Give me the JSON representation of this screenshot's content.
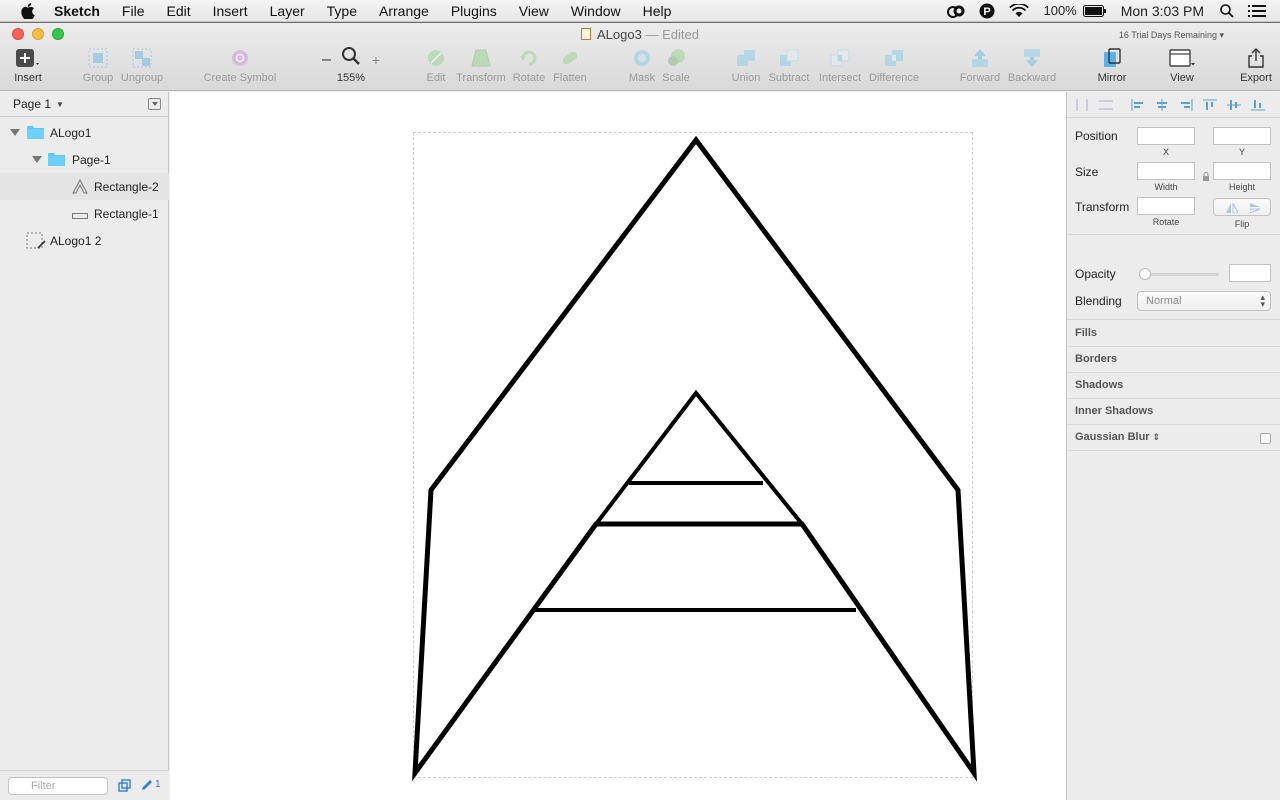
{
  "menubar": {
    "app_name": "Sketch",
    "menus": [
      "File",
      "Edit",
      "Insert",
      "Layer",
      "Type",
      "Arrange",
      "Plugins",
      "View",
      "Window",
      "Help"
    ],
    "battery": "100%",
    "clock": "Mon 3:03 PM"
  },
  "window": {
    "doc_name": "ALogo3",
    "separator": "—",
    "status": "Edited",
    "trial": "16 Trial Days Remaining"
  },
  "toolbar": {
    "insert": "Insert",
    "group": "Group",
    "ungroup": "Ungroup",
    "create_symbol": "Create Symbol",
    "zoom_minus": "–",
    "zoom_plus": "+",
    "zoom_level": "155%",
    "edit": "Edit",
    "transform": "Transform",
    "rotate": "Rotate",
    "flatten": "Flatten",
    "mask": "Mask",
    "scale": "Scale",
    "union": "Union",
    "subtract": "Subtract",
    "intersect": "Intersect",
    "difference": "Difference",
    "forward": "Forward",
    "backward": "Backward",
    "mirror": "Mirror",
    "view": "View",
    "export": "Export"
  },
  "layers": {
    "page": "Page 1",
    "items": [
      {
        "label": "ALogo1"
      },
      {
        "label": "Page-1"
      },
      {
        "label": "Rectangle-2"
      },
      {
        "label": "Rectangle-1"
      },
      {
        "label": "ALogo1 2"
      }
    ],
    "filter_placeholder": "Filter",
    "edited_count": "1"
  },
  "inspector": {
    "position": "Position",
    "x": "X",
    "y": "Y",
    "size": "Size",
    "width": "Width",
    "height": "Height",
    "transform": "Transform",
    "rotate": "Rotate",
    "flip": "Flip",
    "opacity": "Opacity",
    "blending": "Blending",
    "blending_value": "Normal",
    "sections": [
      "Fills",
      "Borders",
      "Shadows",
      "Inner Shadows",
      "Gaussian Blur"
    ]
  },
  "colors": {
    "folder": "#5ac8fa",
    "stroke": "#000000",
    "toolbar_icon": "#59b3e6",
    "boolean_icon": "#7fc8ea",
    "edit_icon": "#8fd08a"
  }
}
